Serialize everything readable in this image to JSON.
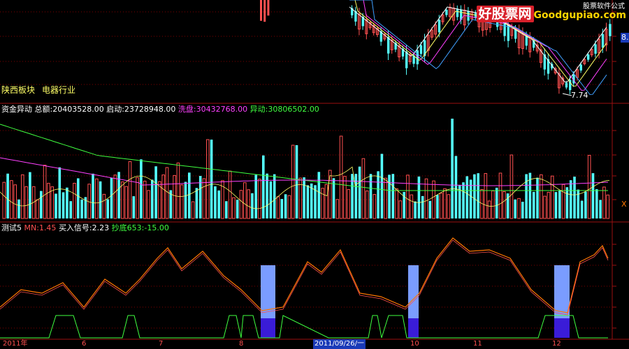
{
  "colors": {
    "up": "#ff5050",
    "down": "#54ffff",
    "grid": "#800000",
    "axis": "#9b1010",
    "yellow": "#ffff66",
    "magenta": "#ff40ff",
    "green": "#40ff40",
    "white": "#ffffff",
    "orange": "#ff7700",
    "blue_bar": "#7a9cff",
    "purple_bar": "#3a1cd8"
  },
  "main_chart": {
    "sector_labels": [
      "陕西板块",
      "电器行业"
    ],
    "price_tag": "8.",
    "low_marker": "7.74"
  },
  "watermark": {
    "brand": "好股票网",
    "site": "Goodgupiao.com",
    "top_text": "股票软件公式"
  },
  "volume_panel": {
    "title": "资金异动",
    "total_label": "总额:",
    "total_value": "20403528.00",
    "start_label": "启动:",
    "start_value": "23728948.00",
    "wash_label": "洗盘:",
    "wash_value": "30432768.00",
    "abnormal_label": "异动:",
    "abnormal_value": "30806502.00",
    "close_marker": "X"
  },
  "indicator_panel": {
    "title": "测试5",
    "mn_label": "MN:",
    "mn_value": "1.45",
    "buy_label": "买入信号:",
    "buy_value": "2.23",
    "bottom_label": "抄底653:",
    "bottom_value": "-15.00"
  },
  "date_axis": {
    "labels": [
      "2011年",
      "6",
      "7",
      "8",
      "2011/09/26/一",
      "10",
      "11",
      "12"
    ]
  }
}
